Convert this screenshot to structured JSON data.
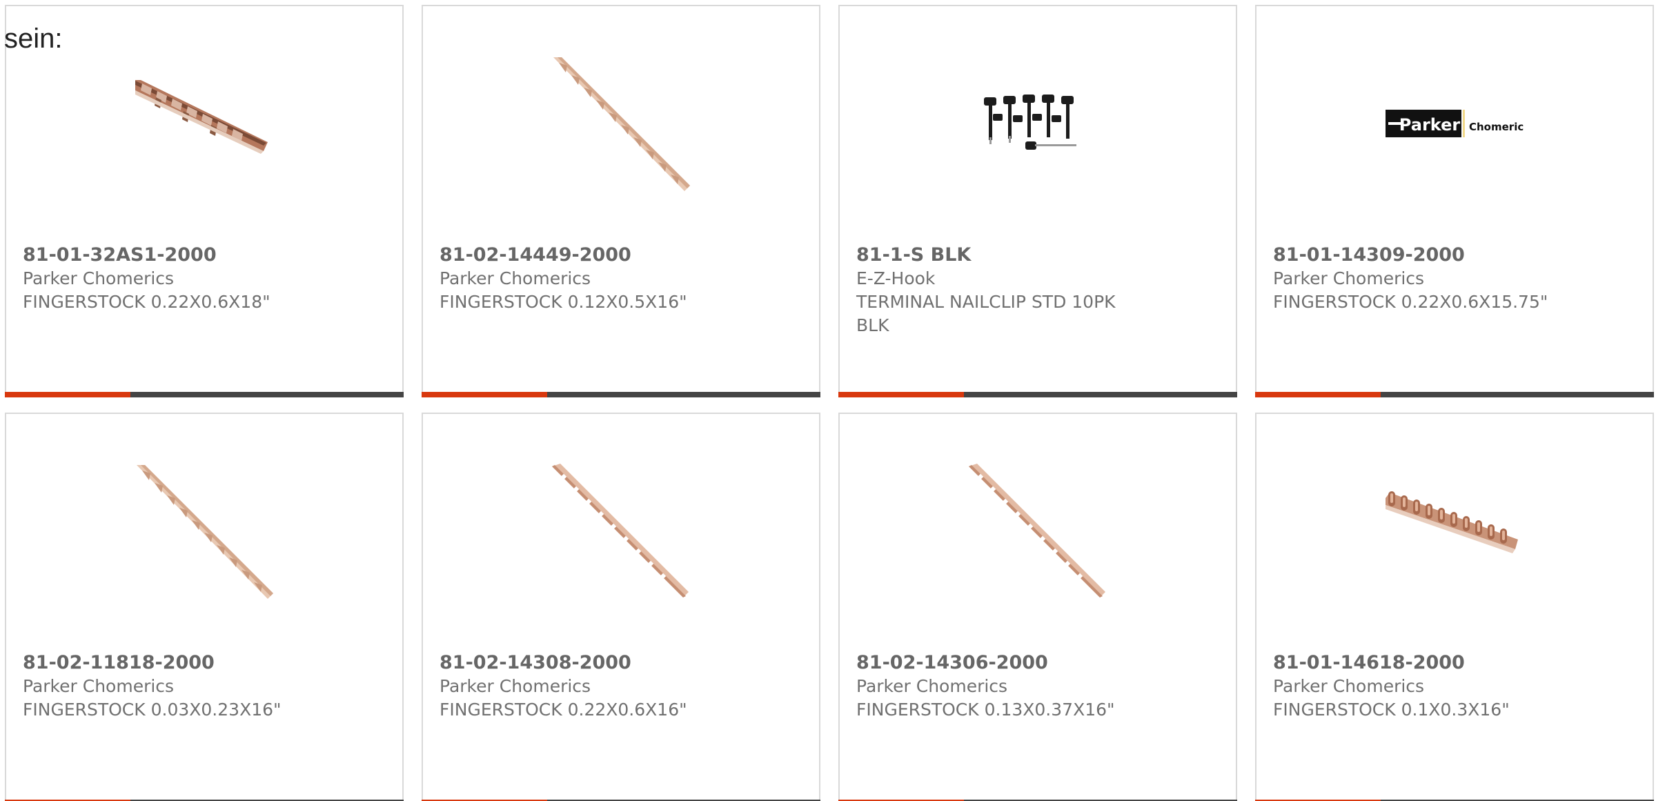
{
  "intro_text": "sein:",
  "colors": {
    "card_border": "#d9d9d9",
    "bar_accent": "#d8380e",
    "bar_rest": "#444444",
    "text": "#666666"
  },
  "products": [
    {
      "part_number": "81-01-32AS1-2000",
      "manufacturer": "Parker Chomerics",
      "description": "FINGERSTOCK 0.22X0.6X18\"",
      "image": "fingerstock-curved-icon"
    },
    {
      "part_number": "81-02-14449-2000",
      "manufacturer": "Parker Chomerics",
      "description": "FINGERSTOCK 0.12X0.5X16\"",
      "image": "fingerstock-diagonal-icon"
    },
    {
      "part_number": "81-1-S BLK",
      "manufacturer": "E-Z-Hook",
      "description": "TERMINAL NAILCLIP STD 10PK BLK",
      "image": "nailclip-pack-icon"
    },
    {
      "part_number": "81-01-14309-2000",
      "manufacturer": "Parker Chomerics",
      "description": "FINGERSTOCK 0.22X0.6X15.75\"",
      "image": "parker-chomerics-logo"
    },
    {
      "part_number": "81-02-11818-2000",
      "manufacturer": "Parker Chomerics",
      "description": "FINGERSTOCK 0.03X0.23X16\"",
      "image": "fingerstock-diagonal-icon"
    },
    {
      "part_number": "81-02-14308-2000",
      "manufacturer": "Parker Chomerics",
      "description": "FINGERSTOCK 0.22X0.6X16\"",
      "image": "fingerstock-slotted-icon"
    },
    {
      "part_number": "81-02-14306-2000",
      "manufacturer": "Parker Chomerics",
      "description": "FINGERSTOCK 0.13X0.37X16\"",
      "image": "fingerstock-slotted-icon"
    },
    {
      "part_number": "81-01-14618-2000",
      "manufacturer": "Parker Chomerics",
      "description": "FINGERSTOCK 0.1X0.3X16\"",
      "image": "fingerstock-coil-icon"
    }
  ],
  "logo": {
    "brand": "Parker",
    "sub": "Chomerics"
  }
}
